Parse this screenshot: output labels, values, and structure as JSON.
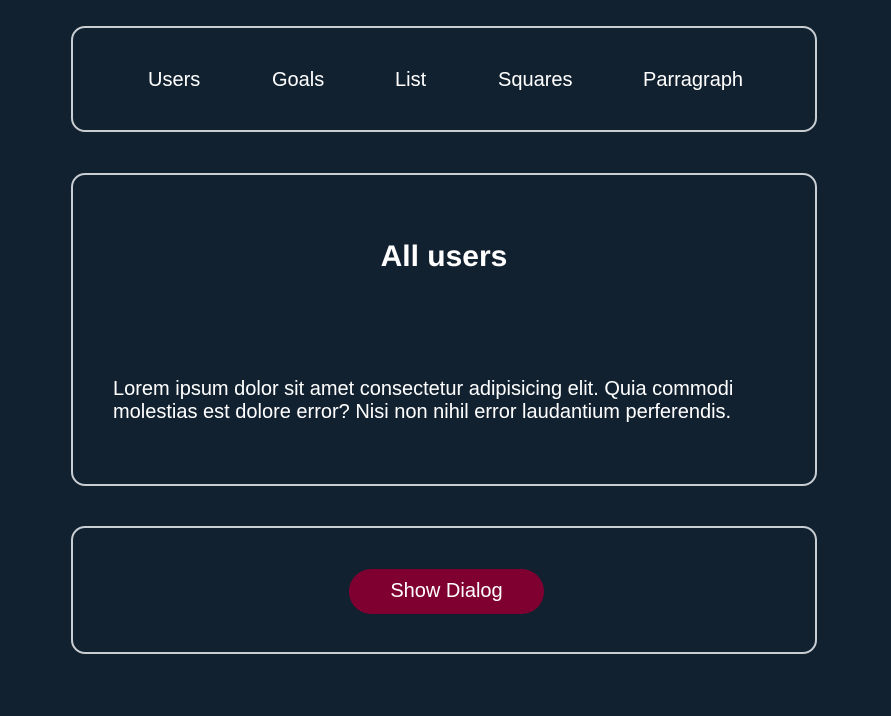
{
  "nav": {
    "items": [
      {
        "label": "Users"
      },
      {
        "label": "Goals"
      },
      {
        "label": "List"
      },
      {
        "label": "Squares"
      },
      {
        "label": "Parragraph"
      }
    ]
  },
  "main": {
    "title": "All users",
    "paragraph": "Lorem ipsum dolor sit amet consectetur adipisicing elit. Quia commodi molestias est dolore error? Nisi non nihil error laudantium perferendis."
  },
  "dialog": {
    "button_label": "Show Dialog"
  },
  "colors": {
    "background": "#122130",
    "border": "#c9ced3",
    "accent": "#7f0030",
    "text": "#ffffff"
  }
}
